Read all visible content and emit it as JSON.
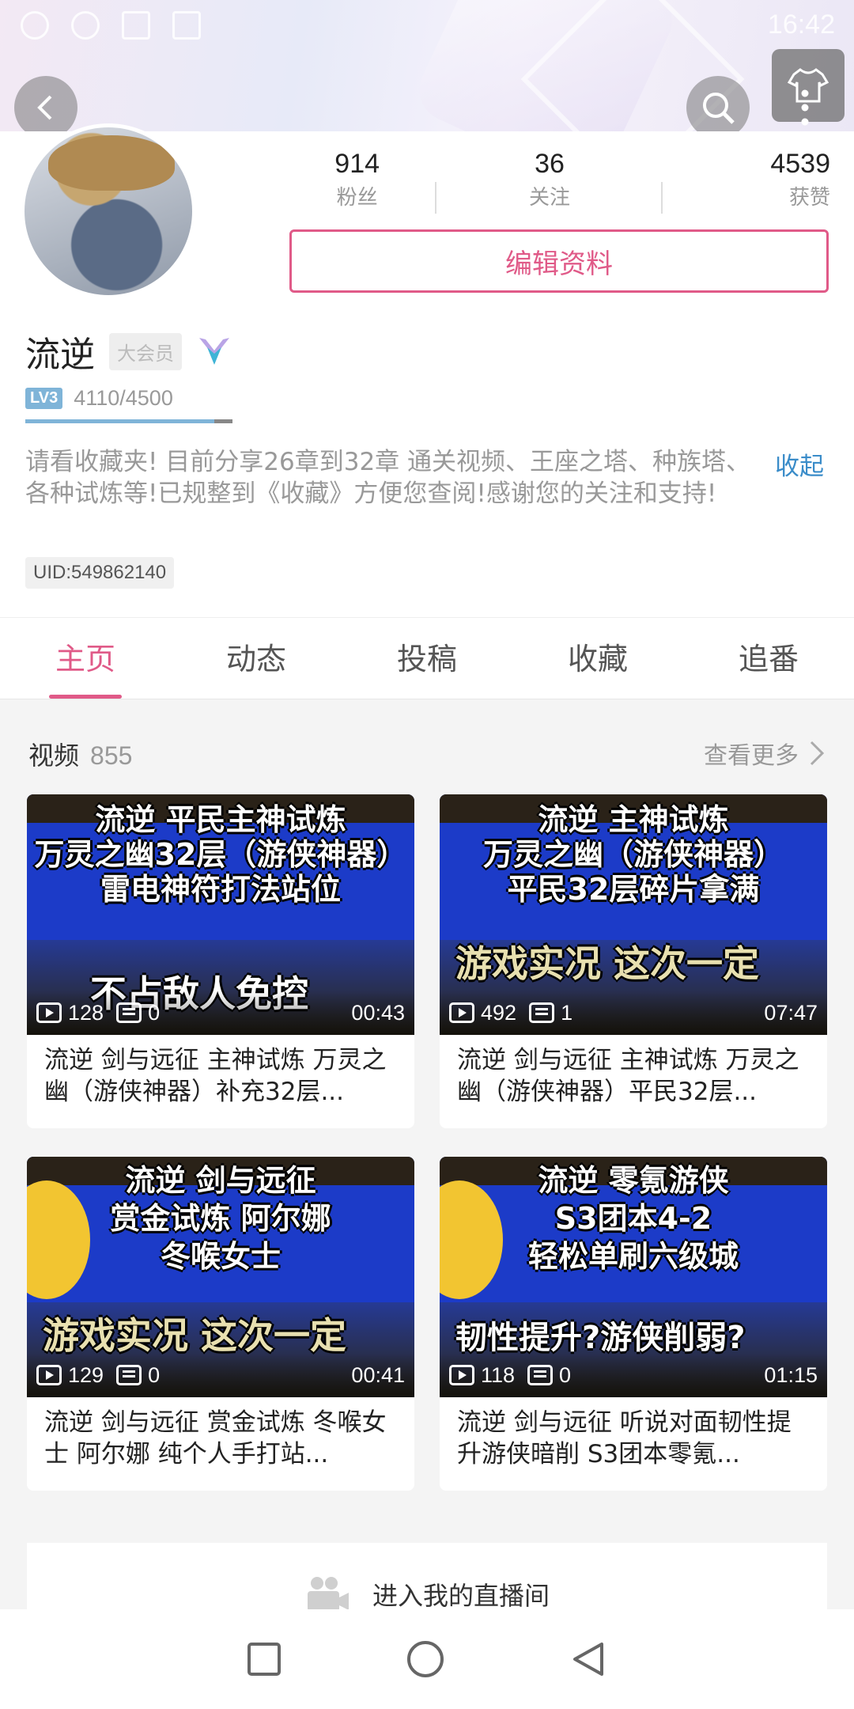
{
  "status": {
    "time": "16:42"
  },
  "profile": {
    "stats": [
      {
        "num": "914",
        "label": "粉丝"
      },
      {
        "num": "36",
        "label": "关注"
      },
      {
        "num": "4539",
        "label": "获赞"
      }
    ],
    "edit_label": "编辑资料",
    "name": "流逆",
    "vip": "大会员",
    "level_badge": "LV3",
    "level_progress": "4110/4500",
    "level_fraction": 0.913,
    "signature": "请看收藏夹! 目前分享26章到32章 通关视频、王座之塔、种族塔、各种试炼等!已规整到《收藏》方便您查阅!感谢您的关注和支持!",
    "fold_label": "收起",
    "uid": "UID:549862140"
  },
  "tabs": [
    "主页",
    "动态",
    "投稿",
    "收藏",
    "追番"
  ],
  "videos": {
    "title": "视频",
    "count": "855",
    "see_more": "查看更多",
    "items": [
      {
        "thumb_lines": [
          "流逆 平民主神试炼",
          "万灵之幽32层（游侠神器）",
          "雷电神符打法站位"
        ],
        "thumb_bottom": "不占敌人免控",
        "plays": "128",
        "danmaku": "0",
        "duration": "00:43",
        "title": "流逆 剑与远征 主神试炼 万灵之幽（游侠神器）补充32层..."
      },
      {
        "thumb_lines": [
          "流逆 主神试炼",
          "万灵之幽（游侠神器）",
          "平民32层碎片拿满"
        ],
        "thumb_bottom": "游戏实况 这次一定",
        "plays": "492",
        "danmaku": "1",
        "duration": "07:47",
        "title": "流逆 剑与远征 主神试炼 万灵之幽（游侠神器）平民32层..."
      },
      {
        "thumb_lines": [
          "流逆 剑与远征",
          "赏金试炼 阿尔娜",
          "冬喉女士"
        ],
        "thumb_bottom": "游戏实况 这次一定",
        "plays": "129",
        "danmaku": "0",
        "duration": "00:41",
        "title": "流逆 剑与远征 赏金试炼 冬喉女士 阿尔娜 纯个人手打站..."
      },
      {
        "thumb_lines": [
          "流逆 零氪游侠",
          "S3团本4-2",
          "轻松单刷六级城"
        ],
        "thumb_bottom": "韧性提升?游侠削弱?",
        "plays": "118",
        "danmaku": "0",
        "duration": "01:15",
        "title": "流逆 剑与远征 听说对面韧性提升游侠暗削 S3团本零氪..."
      }
    ]
  },
  "live": {
    "label": "进入我的直播间"
  },
  "colors": {
    "accent": "#e05a88",
    "link": "#3a8cc9"
  }
}
